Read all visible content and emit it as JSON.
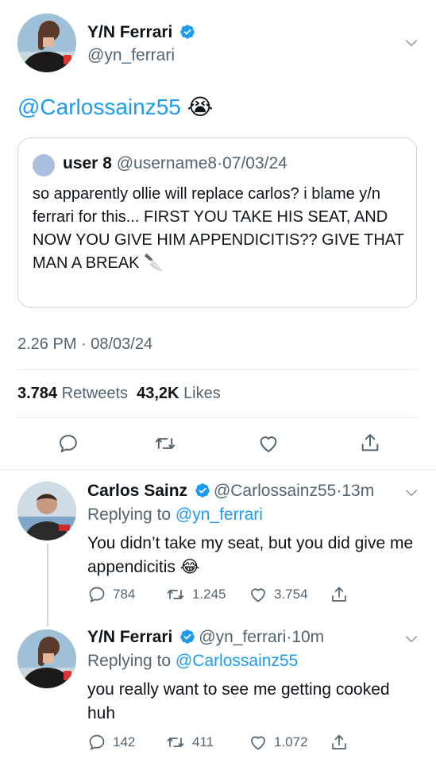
{
  "main_tweet": {
    "author_name": "Y/N Ferrari",
    "author_handle": "@yn_ferrari",
    "text_mention": "@Carlossainz55",
    "text_emoji": "😭",
    "quote": {
      "user_name": "user 8",
      "user_handle": "@username8",
      "separator": "·",
      "date": "07/03/24",
      "text": "so apparently ollie will replace carlos? i blame y/n ferrari for this... FIRST YOU TAKE HIS SEAT, AND NOW YOU GIVE HIM APPENDICITIS?? GIVE THAT MAN A BREAK 🔪"
    },
    "timestamp": "2.26 PM · 08/03/24",
    "retweets_count": "3.784",
    "retweets_label": "Retweets",
    "likes_count": "43,2K",
    "likes_label": "Likes"
  },
  "replies": [
    {
      "author_name": "Carlos Sainz",
      "author_handle": "@Carlossainz55",
      "separator": "·",
      "time": "13m",
      "replying_prefix": "Replying to",
      "replying_to": "@yn_ferrari",
      "text": "You didn’t take my seat, but you did give me appendicitis 😂",
      "replies": "784",
      "retweets": "1.245",
      "likes": "3.754"
    },
    {
      "author_name": "Y/N Ferrari",
      "author_handle": "@yn_ferrari",
      "separator": "·",
      "time": "10m",
      "replying_prefix": "Replying to",
      "replying_to": "@Carlossainz55",
      "text": "you really want to see me getting cooked huh",
      "replies": "142",
      "retweets": "411",
      "likes": "1.072"
    }
  ],
  "colors": {
    "link": "#1d9bf0",
    "verified": "#1d9bf0",
    "secondary": "#536471",
    "divider": "#e7ebee"
  },
  "icons": [
    "verified-badge-icon",
    "chevron-down-icon",
    "reply-icon",
    "retweet-icon",
    "like-icon",
    "share-icon",
    "knife-emoji",
    "crying-emoji",
    "laughing-emoji"
  ]
}
